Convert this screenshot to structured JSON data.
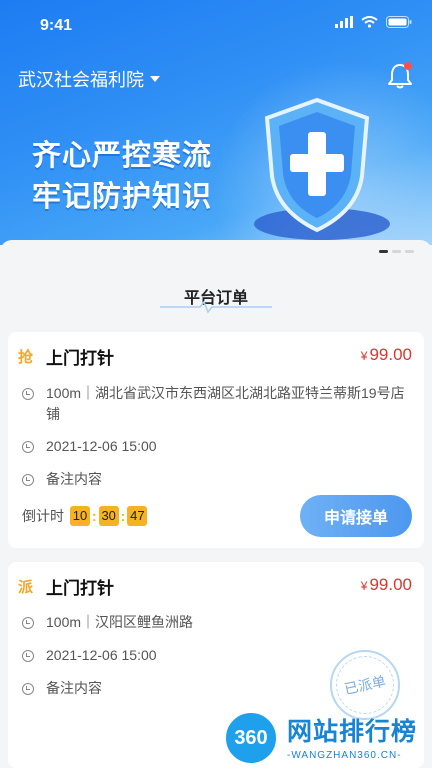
{
  "status_bar": {
    "time": "9:41"
  },
  "header": {
    "org_name": "武汉社会福利院"
  },
  "banner": {
    "line1": "齐心严控寒流",
    "line2": "牢记防护知识"
  },
  "section": {
    "title": "平台订单"
  },
  "orders": [
    {
      "logo_text": "抢",
      "title": "上门打针",
      "price_symbol": "¥",
      "price": "99.00",
      "distance_address": "100m｜湖北省武汉市东西湖区北湖北路亚特兰蒂斯19号店铺",
      "datetime": "2021-12-06 15:00",
      "note": "备注内容",
      "countdown_label": "倒计时",
      "countdown": [
        "10",
        "30",
        "47"
      ],
      "action_label": "申请接单"
    },
    {
      "logo_text": "派",
      "title": "上门打针",
      "price_symbol": "¥",
      "price": "99.00",
      "distance_address": "100m｜汉阳区鲤鱼洲路",
      "datetime": "2021-12-06 15:00",
      "note": "备注内容",
      "stamp_text": "已派单"
    }
  ],
  "watermark": {
    "badge": "360",
    "text": "网站排行榜",
    "sub": "-WANGZHAN360.CN-"
  },
  "colors": {
    "brand_blue": "#1d7cf2",
    "price_red": "#e0342f",
    "countdown_orange": "#f5b323"
  },
  "icons": [
    "signal-icon",
    "wifi-icon",
    "battery-icon",
    "dropdown-caret-icon",
    "bell-icon",
    "shield-icon",
    "distance-icon",
    "clock-icon",
    "note-icon"
  ]
}
